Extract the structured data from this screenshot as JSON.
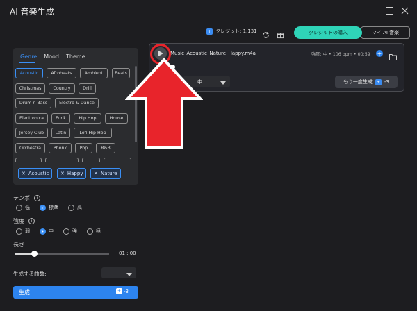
{
  "window": {
    "title": "AI 音楽生成"
  },
  "topbar": {
    "credits": "クレジット: 1,131",
    "buy_label": "クレジットの購入",
    "my_music_label": "マイ AI 音楽"
  },
  "left": {
    "tabs": [
      "Genre",
      "Mood",
      "Theme"
    ],
    "genres": [
      "Acoustic",
      "Afrobeats",
      "Ambient",
      "Beats",
      "Christmas",
      "Country",
      "Drill",
      "Drum n Bass",
      "Electro & Dance",
      "Electronica",
      "Funk",
      "Hip Hop",
      "House",
      "Jersey Club",
      "Latin",
      "Lofi Hip Hop",
      "Orchestra",
      "Phonk",
      "Pop",
      "R&B"
    ],
    "selected_chips": [
      "Acoustic",
      "Happy",
      "Nature"
    ],
    "tempo_label": "テンポ",
    "tempo_options": [
      "低",
      "標準",
      "高"
    ],
    "tempo_selected": "標準",
    "intensity_label": "強度",
    "intensity_options": [
      "弱",
      "中",
      "強",
      "極"
    ],
    "intensity_selected": "中",
    "length_label": "長さ",
    "length_value": "01 : 00",
    "length_fraction": 0.2,
    "count_label": "生成する曲数:",
    "count_value": "1",
    "generate_label": "生成",
    "generate_cost": "-3"
  },
  "result": {
    "filename": "Music_Acoustic_Nature_Happy.m4a",
    "meta": "強度: 中 • 106 bpm • 00:59",
    "intensity_label_partial": "度",
    "intensity_value": "中",
    "regen_label": "もう一度生成",
    "regen_cost": "-3"
  },
  "colors": {
    "accent": "#2d84ef",
    "buy": "#2fd4b8",
    "annotation": "#e8242b"
  }
}
